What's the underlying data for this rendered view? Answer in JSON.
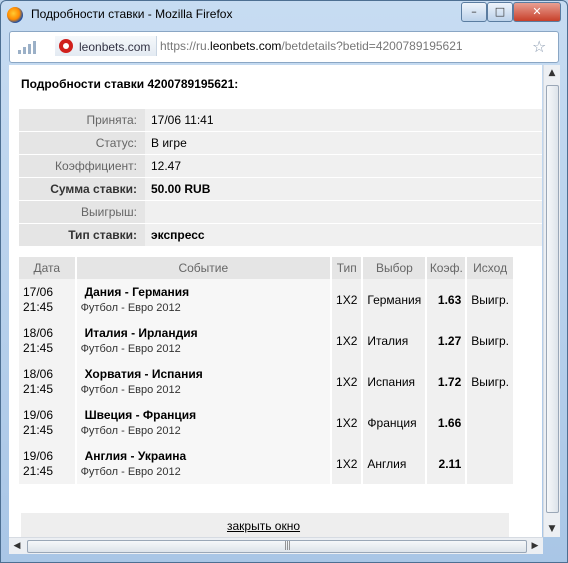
{
  "window": {
    "title": "Подробности ставки - Mozilla Firefox",
    "min": "–",
    "max": "□",
    "close": "✕"
  },
  "urlbar": {
    "site": "leonbets.com",
    "url_prefix": "https://ru.",
    "url_domain": "leonbets.com",
    "url_path": "/betdetails?betid=4200789195621"
  },
  "bet": {
    "title": "Подробности ставки 4200789195621:",
    "info": [
      {
        "label": "Принята:",
        "value": "17/06 11:41",
        "bold": false
      },
      {
        "label": "Статус:",
        "value": "В игре",
        "bold": false
      },
      {
        "label": "Коэффициент:",
        "value": "12.47",
        "bold": false
      },
      {
        "label": "Сумма ставки:",
        "value": "50.00 RUB",
        "bold": true
      },
      {
        "label": "Выигрыш:",
        "value": "",
        "bold": false
      },
      {
        "label": "Тип ставки:",
        "value": "экспресс",
        "bold": true
      }
    ]
  },
  "events": {
    "headers": {
      "date": "Дата",
      "event": "Событие",
      "type": "Тип",
      "pick": "Выбор",
      "coef": "Коэф.",
      "result": "Исход"
    },
    "rows": [
      {
        "date": "17/06",
        "time": "21:45",
        "match": "Дания - Германия",
        "tournament": "Футбол - Евро 2012",
        "type": "1X2",
        "pick": "Германия",
        "coef": "1.63",
        "result": "Выигр."
      },
      {
        "date": "18/06",
        "time": "21:45",
        "match": "Италия - Ирландия",
        "tournament": "Футбол - Евро 2012",
        "type": "1X2",
        "pick": "Италия",
        "coef": "1.27",
        "result": "Выигр."
      },
      {
        "date": "18/06",
        "time": "21:45",
        "match": "Хорватия - Испания",
        "tournament": "Футбол - Евро 2012",
        "type": "1X2",
        "pick": "Испания",
        "coef": "1.72",
        "result": "Выигр."
      },
      {
        "date": "19/06",
        "time": "21:45",
        "match": "Швеция - Франция",
        "tournament": "Футбол - Евро 2012",
        "type": "1X2",
        "pick": "Франция",
        "coef": "1.66",
        "result": ""
      },
      {
        "date": "19/06",
        "time": "21:45",
        "match": "Англия - Украина",
        "tournament": "Футбол - Евро 2012",
        "type": "1X2",
        "pick": "Англия",
        "coef": "2.11",
        "result": ""
      }
    ]
  },
  "footer": {
    "close_link": "закрыть окно"
  },
  "icons": {
    "browser": "firefox-icon",
    "signal": "signal-bars-icon",
    "site": "leonbets-logo-icon",
    "bookmark": "star-icon"
  }
}
